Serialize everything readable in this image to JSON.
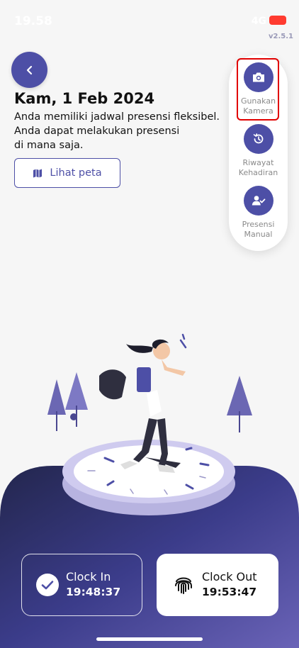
{
  "status_bar": {
    "time": "19.58",
    "network": "4G"
  },
  "version": "v2.5.1",
  "header": {
    "date": "Kam, 1 Feb 2024",
    "description_lines": [
      "Anda memiliki jadwal presensi fleksibel.",
      "Anda dapat melakukan presensi",
      "di mana saja."
    ],
    "map_button_label": "Lihat peta"
  },
  "side_menu": {
    "items": [
      {
        "label_line1": "Gunakan",
        "label_line2": "Kamera",
        "icon": "camera-icon"
      },
      {
        "label_line1": "Riwayat",
        "label_line2": "Kehadiran",
        "icon": "history-icon"
      },
      {
        "label_line1": "Presensi",
        "label_line2": "Manual",
        "icon": "user-check-icon"
      }
    ]
  },
  "clock_in": {
    "label": "Clock In",
    "time": "19:48:37",
    "icon": "check-circle-icon"
  },
  "clock_out": {
    "label": "Clock Out",
    "time": "19:53:47",
    "icon": "fingerprint-icon"
  },
  "colors": {
    "primary": "#4d4fa6",
    "highlight": "#e10000"
  }
}
